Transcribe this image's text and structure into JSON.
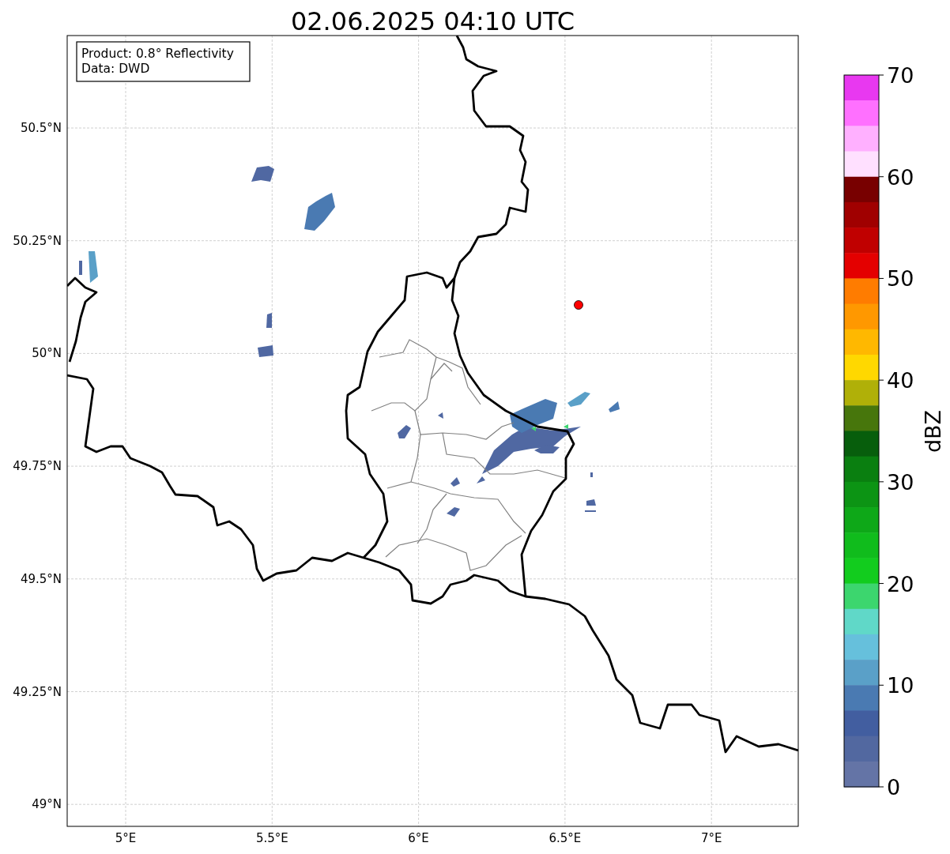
{
  "title": "02.06.2025 04:10 UTC",
  "info_box": [
    "Product: 0.8° Reflectivity",
    "Data: DWD"
  ],
  "map": {
    "lat_ticks": [
      "50.5°N",
      "50.25°N",
      "50°N",
      "49.75°N",
      "49.5°N",
      "49.25°N",
      "49°N"
    ],
    "lon_ticks": [
      "5°E",
      "5.5°E",
      "6°E",
      "6.5°E",
      "7°E"
    ]
  },
  "colorbar": {
    "label": "dBZ",
    "ticks": [
      "70",
      "60",
      "50",
      "40",
      "30",
      "20",
      "10",
      "0"
    ],
    "segments": [
      {
        "color": "#e838f0"
      },
      {
        "color": "#ff70ff"
      },
      {
        "color": "#ffb0ff"
      },
      {
        "color": "#ffe0ff"
      },
      {
        "color": "#780000"
      },
      {
        "color": "#a00000"
      },
      {
        "color": "#c00000"
      },
      {
        "color": "#e40000"
      },
      {
        "color": "#ff7c00"
      },
      {
        "color": "#ff9800"
      },
      {
        "color": "#ffb800"
      },
      {
        "color": "#ffd800"
      },
      {
        "color": "#b0b008"
      },
      {
        "color": "#47760c"
      },
      {
        "color": "#075e0c"
      },
      {
        "color": "#0a7f10"
      },
      {
        "color": "#0c9414"
      },
      {
        "color": "#0ea818"
      },
      {
        "color": "#10bc1c"
      },
      {
        "color": "#12cc1e"
      },
      {
        "color": "#3cd66e"
      },
      {
        "color": "#60d8c8"
      },
      {
        "color": "#66c0dc"
      },
      {
        "color": "#5aa0c8"
      },
      {
        "color": "#4a7ab2"
      },
      {
        "color": "#425ea0"
      },
      {
        "color": "#5268a0"
      },
      {
        "color": "#6474a6"
      }
    ]
  }
}
